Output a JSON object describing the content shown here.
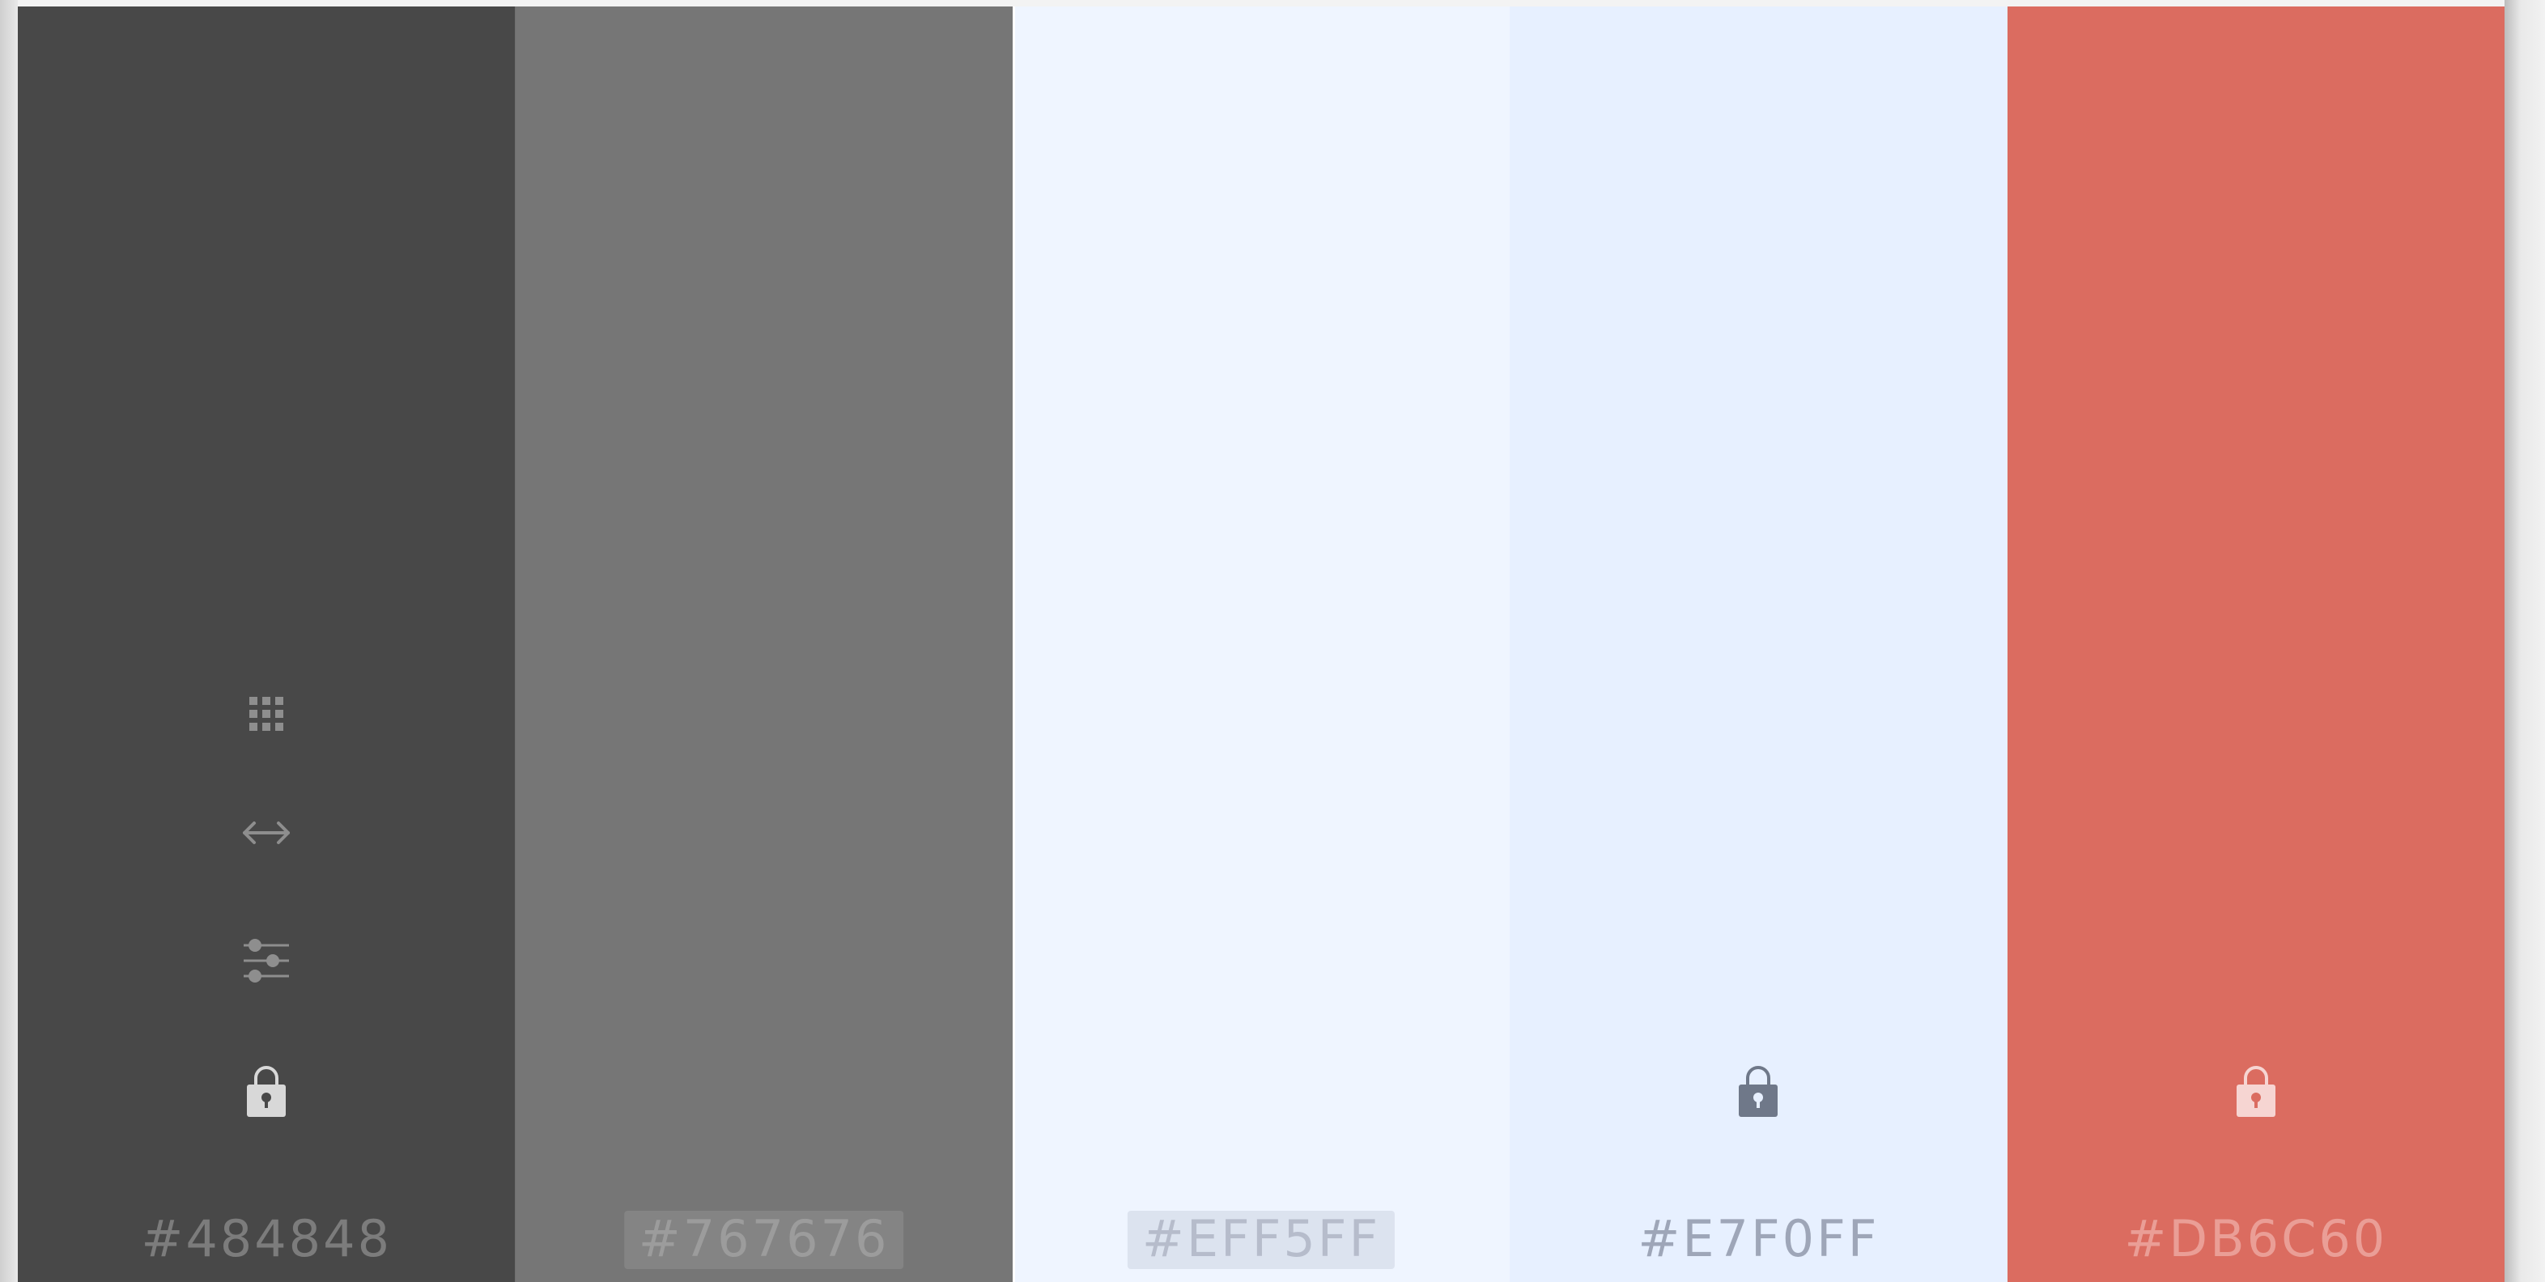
{
  "palette": {
    "swatches": [
      {
        "hex": "#484848",
        "color": "#484848",
        "text_color": "#7c7c7c",
        "icon_color": "#8e8e8e",
        "lock_color": "#d8d8d8",
        "locked": true,
        "show_tools": true
      },
      {
        "hex": "#767676",
        "color": "#767676",
        "text_color": "#9c9c9c",
        "locked": false,
        "show_tools": false
      },
      {
        "hex": "#EFF5FF",
        "color": "#EFF5FF",
        "text_color": "#b6bccb",
        "locked": false,
        "show_tools": false
      },
      {
        "hex": "#E7F0FF",
        "color": "#E7F0FF",
        "text_color": "#9ea6b8",
        "lock_color": "#6f7889",
        "locked": true,
        "show_tools": false
      },
      {
        "hex": "#DB6C60",
        "color": "#DB6C60",
        "text_color": "#ea9e96",
        "lock_color": "#f6d5d2",
        "locked": true,
        "show_tools": false
      }
    ],
    "tool_icons": [
      "grid-icon",
      "resize-arrows-icon",
      "sliders-icon",
      "lock-icon"
    ]
  }
}
